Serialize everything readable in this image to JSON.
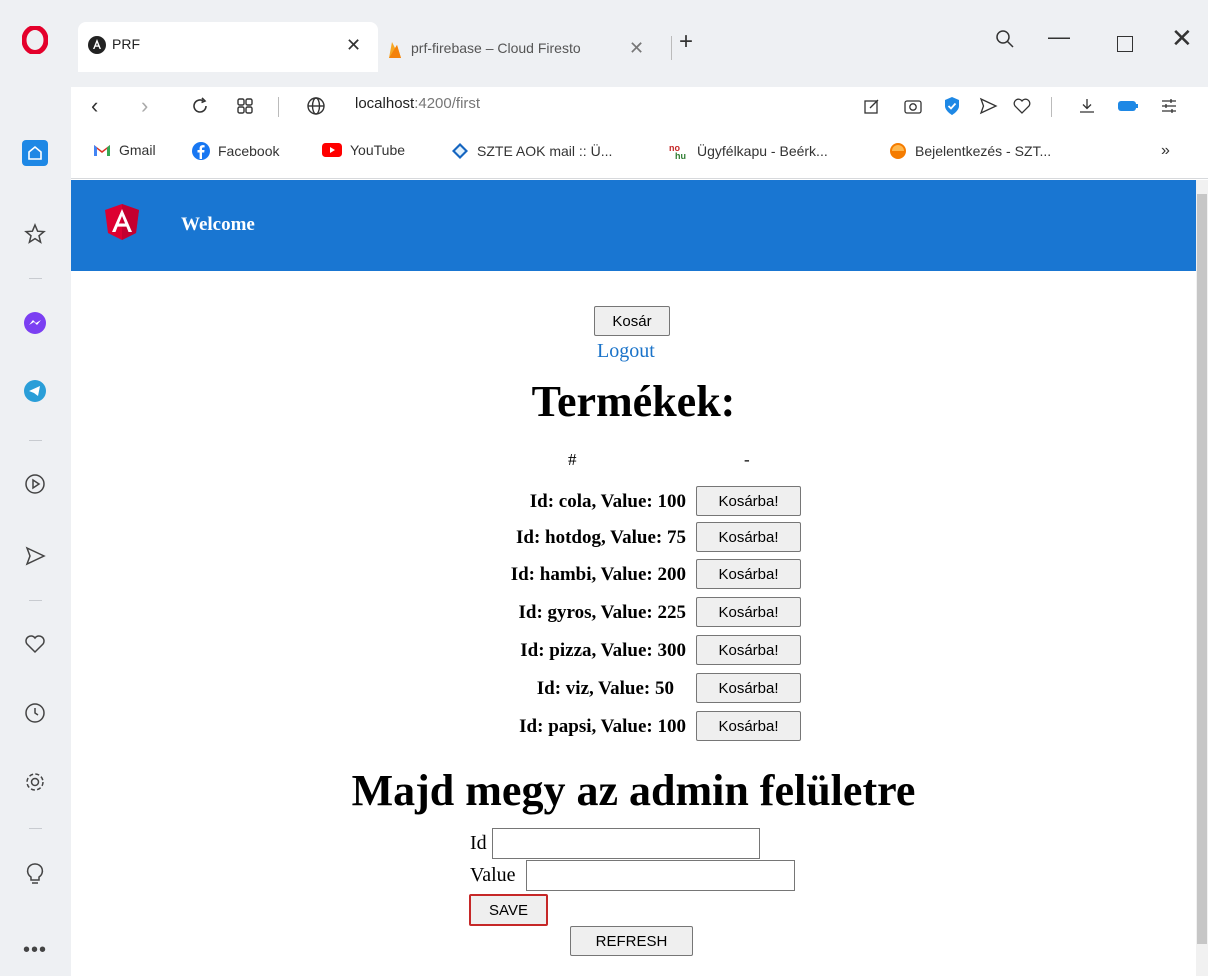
{
  "browser": {
    "tabs": [
      {
        "title": "PRF"
      },
      {
        "title": "prf-firebase – Cloud Firesto"
      }
    ],
    "url": {
      "host": "localhost",
      "path": ":4200/first"
    },
    "bookmarks": [
      {
        "label": "Gmail"
      },
      {
        "label": "Facebook"
      },
      {
        "label": "YouTube"
      },
      {
        "label": "SZTE AOK mail :: Ü..."
      },
      {
        "label": "Ügyfélkapu - Beérk..."
      },
      {
        "label": "Bejelentkezés - SZT..."
      }
    ],
    "more_label": "»",
    "colors": {
      "chrome": "#eef0f3",
      "opera_red": "#e4002b"
    }
  },
  "app": {
    "toolbar_title": "Welcome",
    "toolbar_color": "#1976d2",
    "cart_button": "Kosár",
    "logout_link": "Logout",
    "products_title": "Termékek:",
    "table_header": {
      "col1": "#",
      "col2": "-"
    },
    "products": [
      {
        "label": "Id: cola, Value: 100",
        "button": "Kosárba!"
      },
      {
        "label": "Id: hotdog, Value: 75",
        "button": "Kosárba!"
      },
      {
        "label": "Id: hambi, Value: 200",
        "button": "Kosárba!"
      },
      {
        "label": "Id: gyros, Value: 225",
        "button": "Kosárba!"
      },
      {
        "label": "Id: pizza, Value: 300",
        "button": "Kosárba!"
      },
      {
        "label": "Id: viz, Value: 50",
        "button": "Kosárba!"
      },
      {
        "label": "Id: papsi, Value: 100",
        "button": "Kosárba!"
      }
    ],
    "admin_title": "Majd megy az admin felületre",
    "form": {
      "id_label": "Id",
      "id_value": "",
      "value_label": "Value",
      "value_value": "",
      "save_button": "SAVE",
      "refresh_button": "REFRESH"
    }
  }
}
